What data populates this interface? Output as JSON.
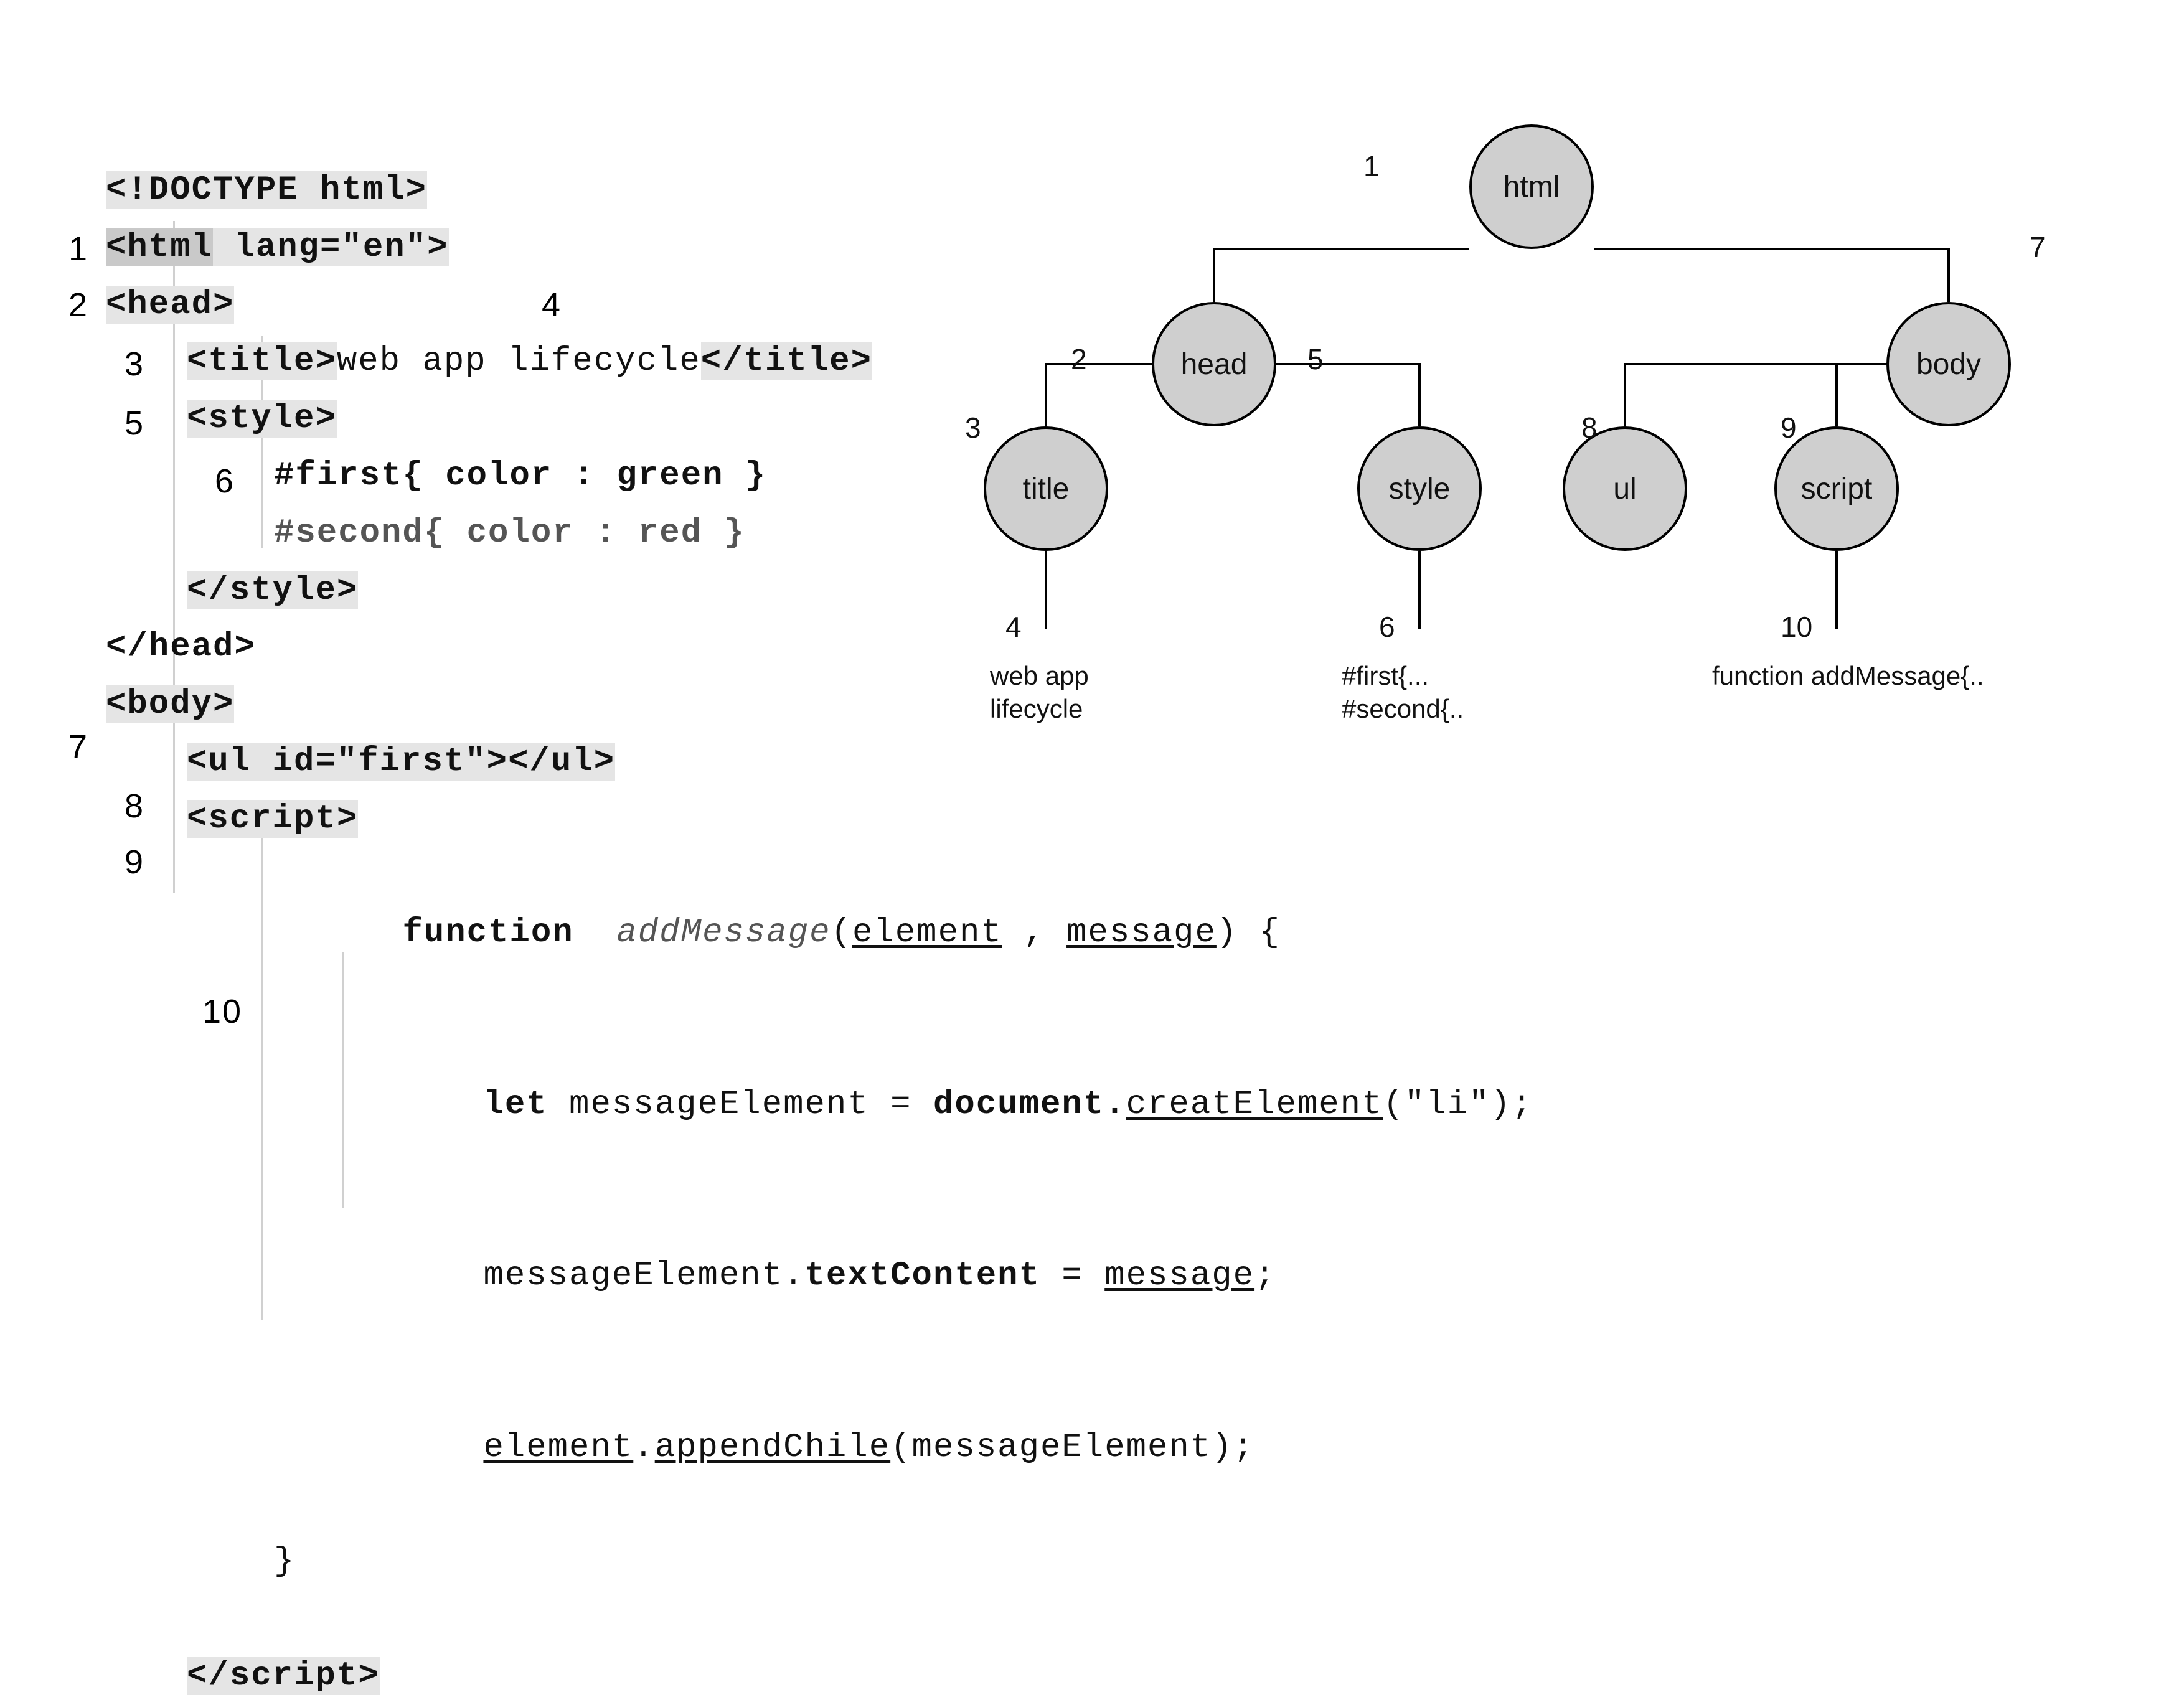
{
  "code": {
    "doctype": "<!DOCTYPE html>",
    "html_open_a": "<html",
    "html_open_b": " lang=\"en\">",
    "head_open": "<head>",
    "title_open": "<title>",
    "title_text": "web app lifecycle",
    "title_close": "</title>",
    "style_open": "<style>",
    "css1": "#first{ color : green }",
    "css2": "#second{ color : red }",
    "style_close": "</style>",
    "head_close": "</head>",
    "body_open": "<body>",
    "ul_line": "<ul id=\"first\"></ul>",
    "script_open": "<script>",
    "fn_kw": "function",
    "fn_name": "addMessage",
    "fn_p1": "element",
    "fn_p2": "message",
    "fn_open": ") {",
    "let_kw": "let",
    "me_var": " messageElement = ",
    "doc_kw": "document.",
    "creat": "creatElement",
    "creat_arg": "(\"li\");",
    "l2a": "messageElement.",
    "l2b": "textContent",
    "l2c": " = ",
    "l2d": "message",
    "l2e": ";",
    "l3a": "element",
    "l3b": ".",
    "l3c": "appendChile",
    "l3d": "(messageElement);",
    "brace_close": "}",
    "script_close_tag": "script"
  },
  "labels": {
    "n1": "1",
    "n2": "2",
    "n3": "3",
    "n4": "4",
    "n5": "5",
    "n6": "6",
    "n7": "7",
    "n8": "8",
    "n9": "9",
    "n10": "10"
  },
  "tree": {
    "html": "html",
    "head": "head",
    "body": "body",
    "title": "title",
    "style": "style",
    "ul": "ul",
    "script": "script",
    "leaf_title_a": "web app",
    "leaf_title_b": "lifecycle",
    "leaf_style_a": "#first{...",
    "leaf_style_b": "#second{..",
    "leaf_script": "function addMessage{.."
  },
  "tree_labels": {
    "n1": "1",
    "n2": "2",
    "n3": "3",
    "n4": "4",
    "n5": "5",
    "n6": "6",
    "n7": "7",
    "n8": "8",
    "n9": "9",
    "n10": "10"
  }
}
